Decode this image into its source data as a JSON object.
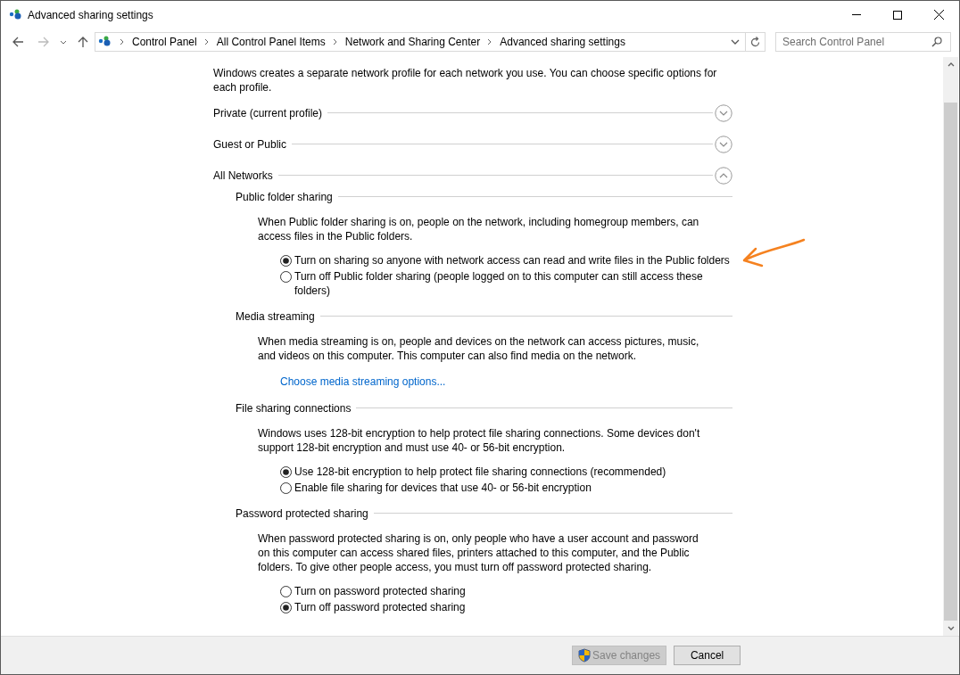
{
  "window": {
    "title": "Advanced sharing settings"
  },
  "breadcrumb": [
    "Control Panel",
    "All Control Panel Items",
    "Network and Sharing Center",
    "Advanced sharing settings"
  ],
  "search": {
    "placeholder": "Search Control Panel"
  },
  "intro": "Windows creates a separate network profile for each network you use. You can choose specific options for each profile.",
  "profiles": [
    {
      "label": "Private (current profile)",
      "expanded": false
    },
    {
      "label": "Guest or Public",
      "expanded": false
    },
    {
      "label": "All Networks",
      "expanded": true
    }
  ],
  "sections": [
    {
      "title": "Public folder sharing",
      "description": "When Public folder sharing is on, people on the network, including homegroup members, can access files in the Public folders.",
      "options": [
        {
          "label": "Turn on sharing so anyone with network access can read and write files in the Public folders",
          "selected": true
        },
        {
          "label": "Turn off Public folder sharing (people logged on to this computer can still access these folders)",
          "selected": false
        }
      ]
    },
    {
      "title": "Media streaming",
      "description": "When media streaming is on, people and devices on the network can access pictures, music, and videos on this computer. This computer can also find media on the network.",
      "link": "Choose media streaming options..."
    },
    {
      "title": "File sharing connections",
      "description": "Windows uses 128-bit encryption to help protect file sharing connections. Some devices don't support 128-bit encryption and must use 40- or 56-bit encryption.",
      "options": [
        {
          "label": "Use 128-bit encryption to help protect file sharing connections (recommended)",
          "selected": true
        },
        {
          "label": "Enable file sharing for devices that use 40- or 56-bit encryption",
          "selected": false
        }
      ]
    },
    {
      "title": "Password protected sharing",
      "description": "When password protected sharing is on, only people who have a user account and password on this computer can access shared files, printers attached to this computer, and the Public folders. To give other people access, you must turn off password protected sharing.",
      "options": [
        {
          "label": "Turn on password protected sharing",
          "selected": false
        },
        {
          "label": "Turn off password protected sharing",
          "selected": true
        }
      ]
    }
  ],
  "buttons": [
    {
      "label": "Save changes",
      "disabled": true,
      "kind": "shield"
    },
    {
      "label": "Cancel",
      "disabled": false,
      "kind": "plain"
    }
  ]
}
